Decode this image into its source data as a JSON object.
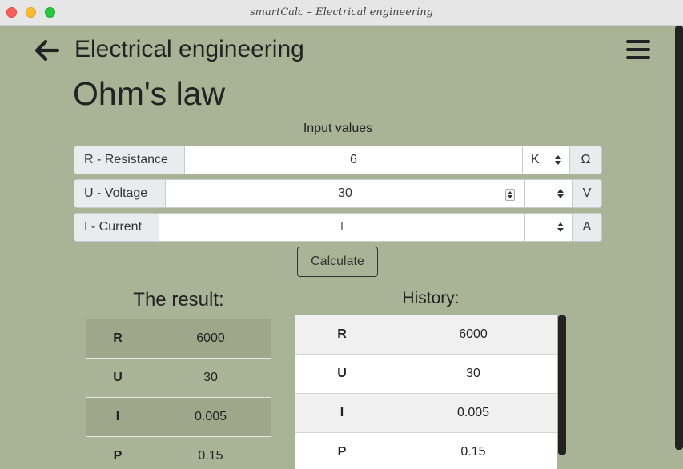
{
  "window": {
    "title": "smartCalc – Electrical engineering"
  },
  "header": {
    "title": "Electrical engineering"
  },
  "page": {
    "title": "Ohm's law",
    "input_heading": "Input values"
  },
  "inputs": [
    {
      "label": "R - Resistance",
      "value": "6",
      "prefix": "K",
      "unit": "Ω"
    },
    {
      "label": "U - Voltage",
      "value": "30",
      "prefix": "",
      "unit": "V"
    },
    {
      "label": "I - Current",
      "value": "I",
      "prefix": "",
      "unit": "A"
    }
  ],
  "calculate_label": "Calculate",
  "result": {
    "title": "The result:",
    "rows": [
      {
        "key": "R",
        "value": "6000"
      },
      {
        "key": "U",
        "value": "30"
      },
      {
        "key": "I",
        "value": "0.005"
      },
      {
        "key": "P",
        "value": "0.15"
      }
    ]
  },
  "history": {
    "title": "History:",
    "rows": [
      {
        "key": "R",
        "value": "6000"
      },
      {
        "key": "U",
        "value": "30"
      },
      {
        "key": "I",
        "value": "0.005"
      },
      {
        "key": "P",
        "value": "0.15"
      }
    ]
  },
  "icons": {
    "back": "arrow-left-icon",
    "menu": "hamburger-menu-icon"
  }
}
